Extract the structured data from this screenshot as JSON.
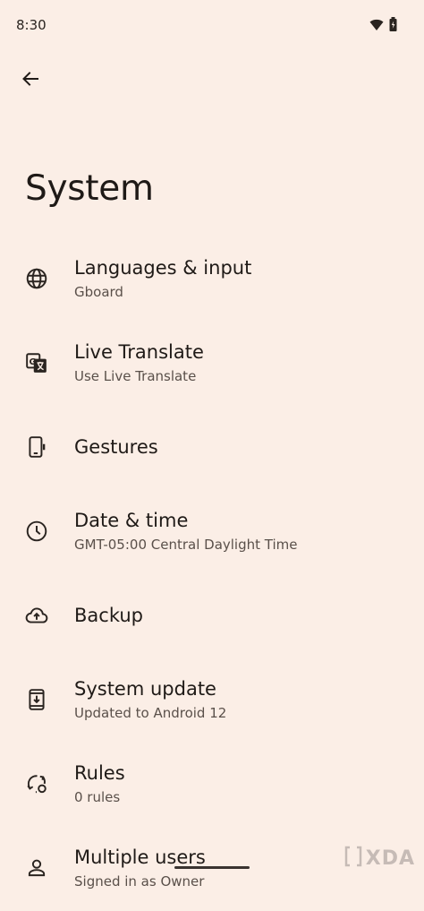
{
  "status_bar": {
    "time": "8:30",
    "icons": [
      "wifi-icon",
      "battery-icon"
    ]
  },
  "header": {
    "back_icon": "arrow-back-icon",
    "title": "System"
  },
  "items": [
    {
      "icon": "globe-icon",
      "title": "Languages & input",
      "subtitle": "Gboard"
    },
    {
      "icon": "translate-icon",
      "title": "Live Translate",
      "subtitle": "Use Live Translate"
    },
    {
      "icon": "phone-gesture-icon",
      "title": "Gestures",
      "subtitle": ""
    },
    {
      "icon": "clock-icon",
      "title": "Date & time",
      "subtitle": "GMT-05:00 Central Daylight Time"
    },
    {
      "icon": "cloud-upload-icon",
      "title": "Backup",
      "subtitle": ""
    },
    {
      "icon": "system-update-icon",
      "title": "System update",
      "subtitle": "Updated to Android 12"
    },
    {
      "icon": "rules-icon",
      "title": "Rules",
      "subtitle": "0 rules"
    },
    {
      "icon": "person-icon",
      "title": "Multiple users",
      "subtitle": "Signed in as Owner"
    }
  ],
  "watermark": {
    "text": "XDA"
  },
  "colors": {
    "background": "#fbeee6",
    "text_primary": "#1f1a17",
    "text_secondary": "#5a504a"
  }
}
